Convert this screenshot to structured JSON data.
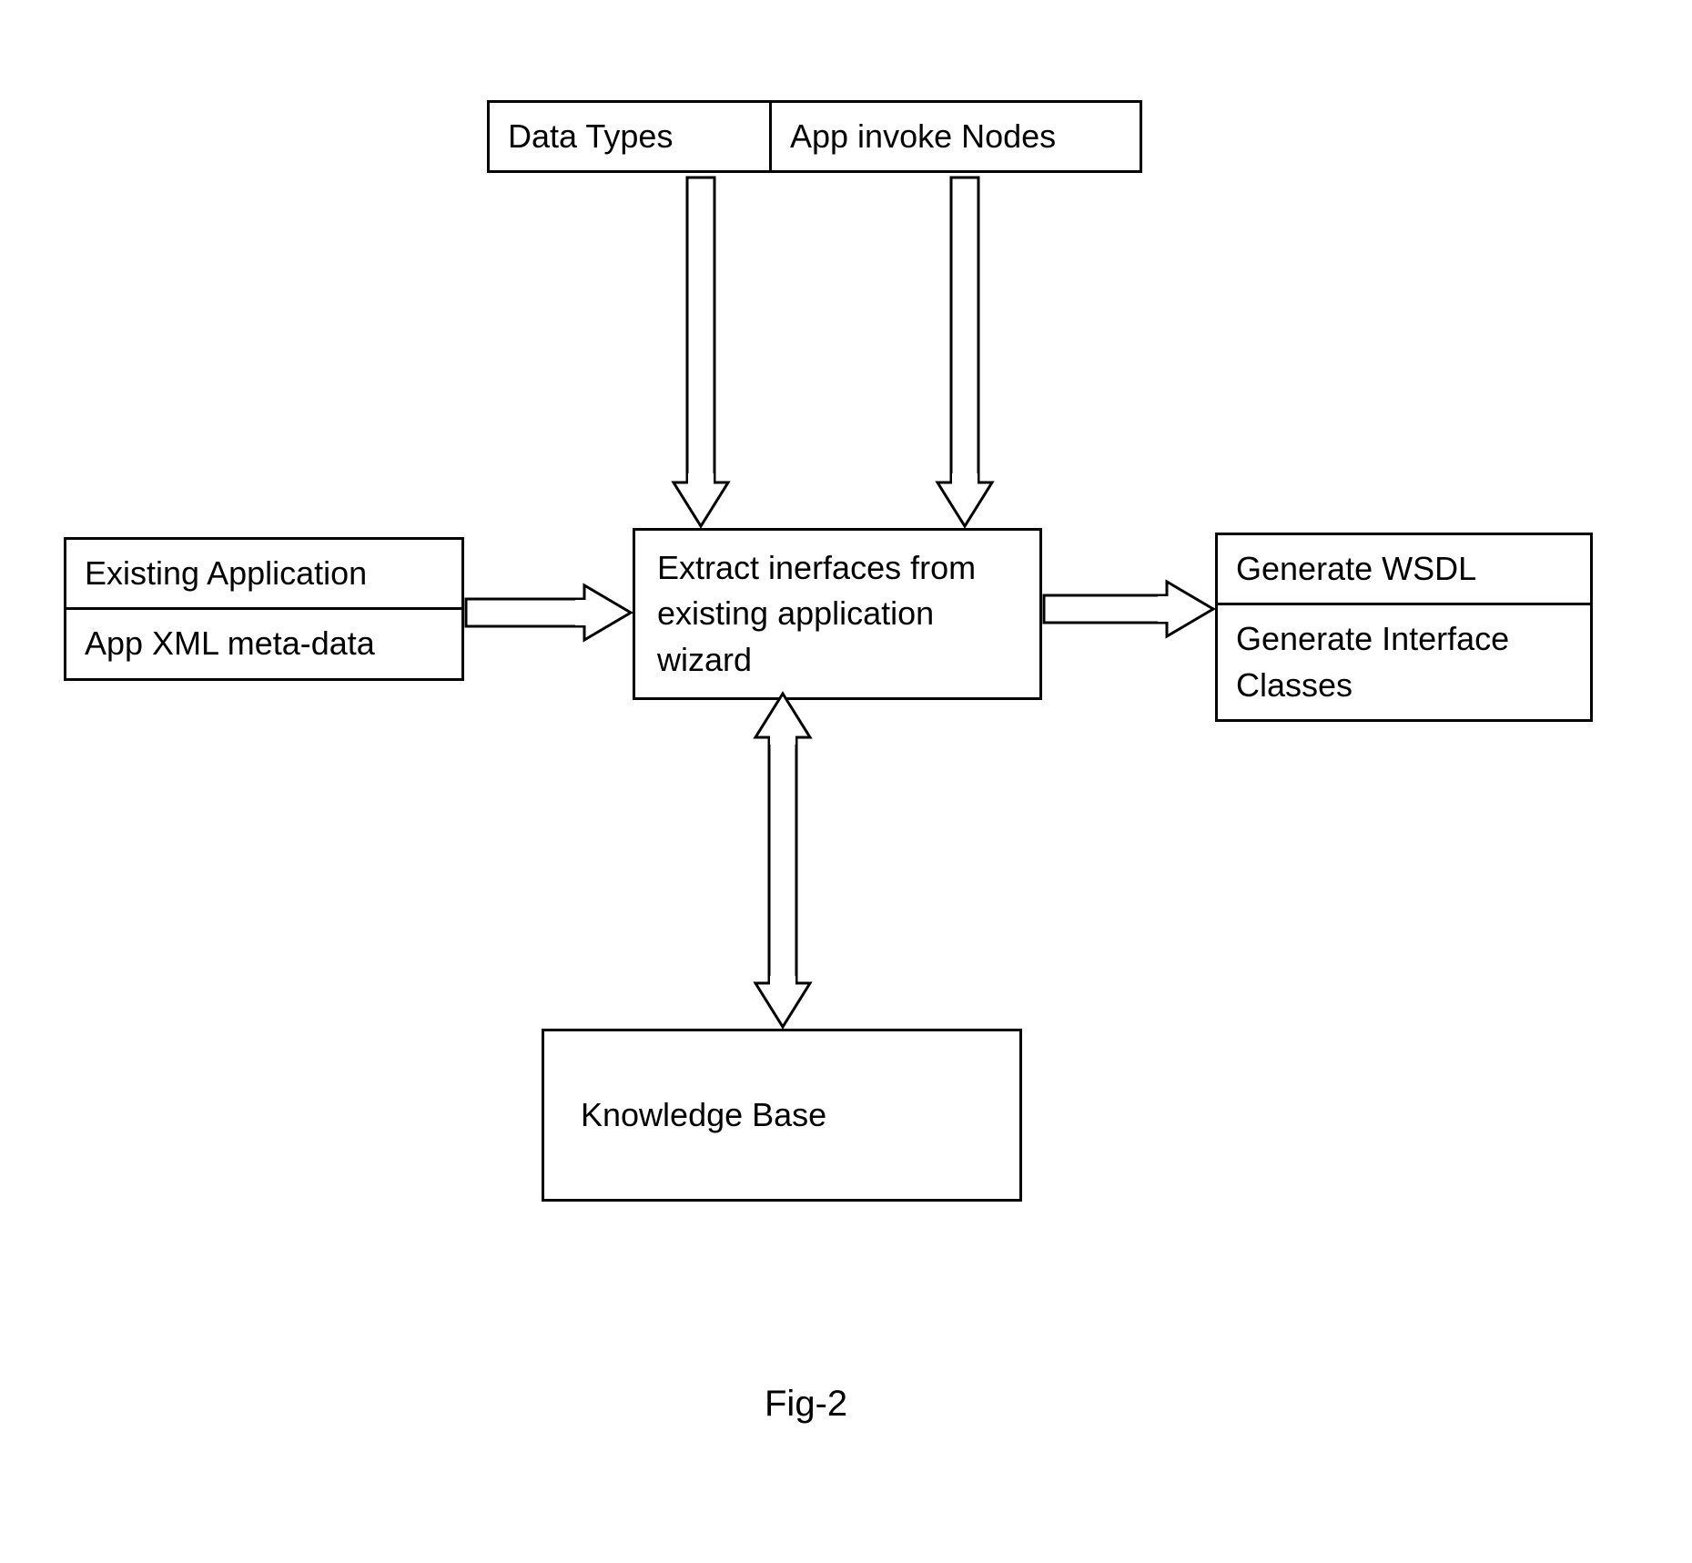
{
  "boxes": {
    "top": {
      "left": "Data Types",
      "right": "App invoke Nodes"
    },
    "left": {
      "top": "Existing Application",
      "bottom": "App XML meta-data"
    },
    "center": "Extract inerfaces from existing application wizard",
    "right": {
      "top": "Generate WSDL",
      "bottom": "Generate Interface Classes"
    },
    "bottom": "Knowledge Base"
  },
  "caption": "Fig-2"
}
